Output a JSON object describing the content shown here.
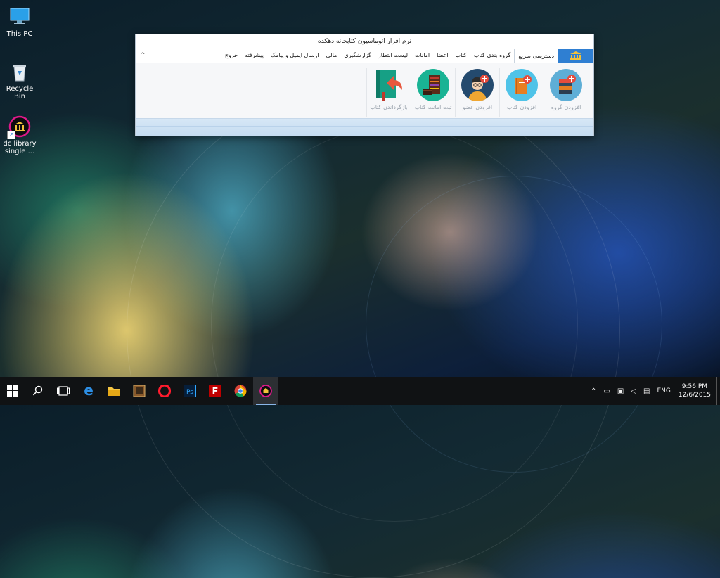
{
  "desktop": {
    "icons": [
      {
        "label": "This PC"
      },
      {
        "label": "Recycle Bin"
      },
      {
        "label": "dc library single ..."
      }
    ]
  },
  "window": {
    "title": "نرم افزار اتوماسیون کتابخانه دهکده",
    "tabs": [
      {
        "label": "دسترسی سریع"
      },
      {
        "label": "گروه بندی کتاب"
      },
      {
        "label": "کتاب"
      },
      {
        "label": "اعضا"
      },
      {
        "label": "امانات"
      },
      {
        "label": "لیست انتظار"
      },
      {
        "label": "گزارشگیری"
      },
      {
        "label": "مالی"
      },
      {
        "label": "ارسال ایمیل و پیامک"
      },
      {
        "label": "پیشرفته"
      },
      {
        "label": "خروج"
      }
    ],
    "collapse_glyph": "^",
    "buttons": [
      {
        "label": "افزودن گروه",
        "icon": "add-group-icon"
      },
      {
        "label": "افزودن کتاب",
        "icon": "add-book-icon"
      },
      {
        "label": "افزودن عضو",
        "icon": "add-member-icon"
      },
      {
        "label": "ثبت امانت کتاب",
        "icon": "loan-book-icon"
      },
      {
        "label": "بازگرداندن کتاب",
        "icon": "return-book-icon"
      }
    ]
  },
  "taskbar": {
    "items": [
      "start-icon",
      "search-icon",
      "task-view-icon",
      "edge-icon",
      "file-explorer-icon",
      "app-icon",
      "opera-icon",
      "photoshop-icon",
      "filezilla-icon",
      "chrome-icon",
      "dc-library-icon"
    ],
    "language": "ENG",
    "time": "9:56 PM",
    "date": "12/6/2015"
  },
  "colors": {
    "accent": "#2f7fd2",
    "library_logo": "#e0198a"
  }
}
